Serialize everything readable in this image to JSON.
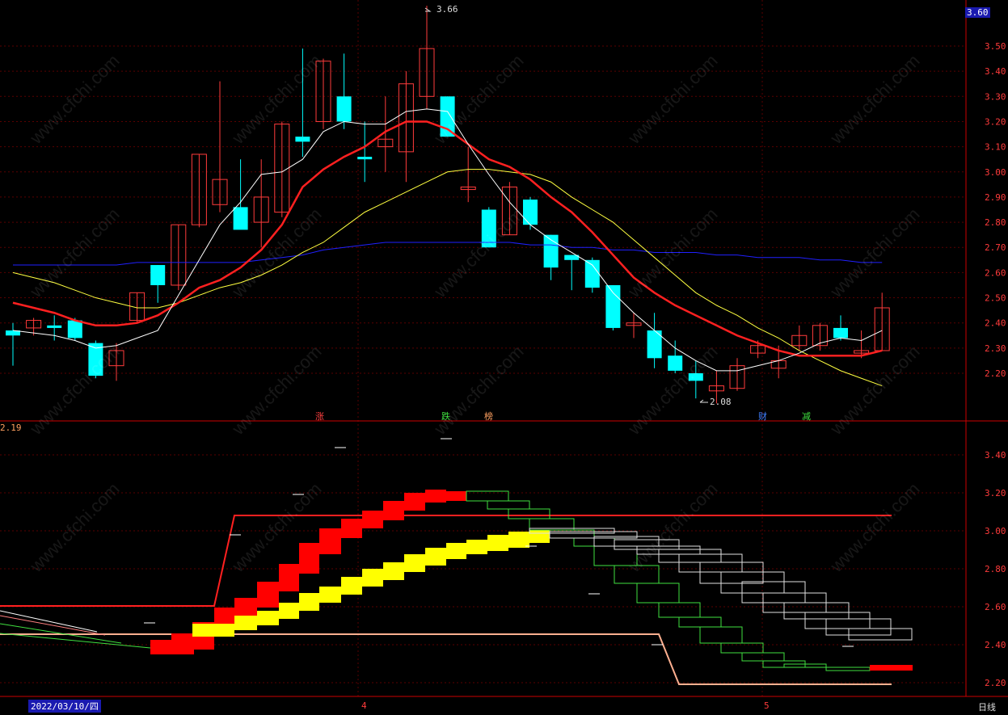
{
  "header": {
    "current_price": "3.60"
  },
  "main_axis_ticks": [
    "3.50",
    "3.40",
    "3.30",
    "3.20",
    "3.10",
    "3.00",
    "2.90",
    "2.80",
    "2.70",
    "2.60",
    "2.50",
    "2.40",
    "2.30",
    "2.20"
  ],
  "lower_axis_ticks": [
    "3.40",
    "3.20",
    "3.00",
    "2.80",
    "2.60",
    "2.40",
    "2.20"
  ],
  "lower_panel": {
    "left_value": "2.19"
  },
  "annotations": {
    "high": "3.66",
    "low": "2.08"
  },
  "markers": [
    {
      "text": "涨",
      "color": "#ff4040"
    },
    {
      "text": "跌",
      "color": "#40e040"
    },
    {
      "text": "榜",
      "color": "#ffa060"
    },
    {
      "text": "财",
      "color": "#4080ff"
    },
    {
      "text": "减",
      "color": "#40e040"
    }
  ],
  "footer": {
    "date": "2022/03/10/四",
    "month_4": "4",
    "month_5": "5",
    "period": "日线"
  },
  "watermark": "www.cfchi.com",
  "colors": {
    "up": "#ff3b3b",
    "down": "#00ffff",
    "ma5": "#ffffff",
    "ma10": "#ff2020",
    "ma20": "#ffff40",
    "ma60": "#2020ff",
    "grid": "#5a0000"
  },
  "chart_data": {
    "type": "candlestick",
    "ylim": [
      2.15,
      3.68
    ],
    "candles": [
      {
        "o": 2.37,
        "h": 2.4,
        "l": 2.23,
        "c": 2.35
      },
      {
        "o": 2.38,
        "h": 2.42,
        "l": 2.35,
        "c": 2.41
      },
      {
        "o": 2.39,
        "h": 2.43,
        "l": 2.33,
        "c": 2.38
      },
      {
        "o": 2.41,
        "h": 2.42,
        "l": 2.33,
        "c": 2.34
      },
      {
        "o": 2.32,
        "h": 2.33,
        "l": 2.18,
        "c": 2.19
      },
      {
        "o": 2.23,
        "h": 2.32,
        "l": 2.17,
        "c": 2.29
      },
      {
        "o": 2.41,
        "h": 2.52,
        "l": 2.4,
        "c": 2.52
      },
      {
        "o": 2.63,
        "h": 2.63,
        "l": 2.48,
        "c": 2.55
      },
      {
        "o": 2.55,
        "h": 2.79,
        "l": 2.53,
        "c": 2.79
      },
      {
        "o": 2.79,
        "h": 3.07,
        "l": 2.78,
        "c": 3.07
      },
      {
        "o": 2.87,
        "h": 3.36,
        "l": 2.84,
        "c": 2.97
      },
      {
        "o": 2.86,
        "h": 3.05,
        "l": 2.78,
        "c": 2.77
      },
      {
        "o": 2.8,
        "h": 3.05,
        "l": 2.7,
        "c": 2.9
      },
      {
        "o": 2.84,
        "h": 3.2,
        "l": 2.82,
        "c": 3.19
      },
      {
        "o": 3.14,
        "h": 3.49,
        "l": 3.06,
        "c": 3.12
      },
      {
        "o": 3.2,
        "h": 3.45,
        "l": 3.17,
        "c": 3.44
      },
      {
        "o": 3.3,
        "h": 3.47,
        "l": 3.17,
        "c": 3.2
      },
      {
        "o": 3.06,
        "h": 3.2,
        "l": 2.96,
        "c": 3.05
      },
      {
        "o": 3.1,
        "h": 3.3,
        "l": 3.0,
        "c": 3.13
      },
      {
        "o": 3.08,
        "h": 3.4,
        "l": 2.96,
        "c": 3.35
      },
      {
        "o": 3.3,
        "h": 3.66,
        "l": 3.25,
        "c": 3.49
      },
      {
        "o": 3.3,
        "h": 3.3,
        "l": 3.14,
        "c": 3.14
      },
      {
        "o": 2.93,
        "h": 3.1,
        "l": 2.88,
        "c": 2.94
      },
      {
        "o": 2.85,
        "h": 2.86,
        "l": 2.7,
        "c": 2.7
      },
      {
        "o": 2.75,
        "h": 2.96,
        "l": 2.75,
        "c": 2.94
      },
      {
        "o": 2.89,
        "h": 2.9,
        "l": 2.77,
        "c": 2.79
      },
      {
        "o": 2.75,
        "h": 2.75,
        "l": 2.57,
        "c": 2.62
      },
      {
        "o": 2.67,
        "h": 2.67,
        "l": 2.53,
        "c": 2.65
      },
      {
        "o": 2.65,
        "h": 2.66,
        "l": 2.52,
        "c": 2.54
      },
      {
        "o": 2.55,
        "h": 2.55,
        "l": 2.37,
        "c": 2.38
      },
      {
        "o": 2.39,
        "h": 2.44,
        "l": 2.34,
        "c": 2.4
      },
      {
        "o": 2.37,
        "h": 2.44,
        "l": 2.22,
        "c": 2.26
      },
      {
        "o": 2.27,
        "h": 2.33,
        "l": 2.2,
        "c": 2.21
      },
      {
        "o": 2.2,
        "h": 2.25,
        "l": 2.1,
        "c": 2.17
      },
      {
        "o": 2.13,
        "h": 2.21,
        "l": 2.08,
        "c": 2.15
      },
      {
        "o": 2.14,
        "h": 2.26,
        "l": 2.13,
        "c": 2.23
      },
      {
        "o": 2.28,
        "h": 2.33,
        "l": 2.26,
        "c": 2.31
      },
      {
        "o": 2.22,
        "h": 2.31,
        "l": 2.18,
        "c": 2.25
      },
      {
        "o": 2.31,
        "h": 2.39,
        "l": 2.29,
        "c": 2.35
      },
      {
        "o": 2.31,
        "h": 2.4,
        "l": 2.29,
        "c": 2.39
      },
      {
        "o": 2.38,
        "h": 2.43,
        "l": 2.33,
        "c": 2.34
      },
      {
        "o": 2.28,
        "h": 2.37,
        "l": 2.26,
        "c": 2.29
      },
      {
        "o": 2.29,
        "h": 2.52,
        "l": 2.29,
        "c": 2.46
      }
    ],
    "ma5": [
      2.37,
      2.36,
      2.35,
      2.33,
      2.3,
      2.31,
      2.34,
      2.37,
      2.51,
      2.65,
      2.79,
      2.88,
      2.99,
      3.0,
      3.05,
      3.16,
      3.2,
      3.19,
      3.19,
      3.24,
      3.25,
      3.24,
      3.11,
      2.99,
      2.88,
      2.79,
      2.73,
      2.68,
      2.63,
      2.52,
      2.44,
      2.37,
      2.3,
      2.25,
      2.21,
      2.21,
      2.23,
      2.25,
      2.28,
      2.32,
      2.34,
      2.33,
      2.37
    ],
    "ma10": [
      2.48,
      2.46,
      2.44,
      2.41,
      2.39,
      2.39,
      2.4,
      2.43,
      2.48,
      2.54,
      2.57,
      2.62,
      2.69,
      2.79,
      2.94,
      3.01,
      3.06,
      3.1,
      3.16,
      3.2,
      3.2,
      3.17,
      3.11,
      3.05,
      3.02,
      2.97,
      2.9,
      2.84,
      2.76,
      2.67,
      2.58,
      2.52,
      2.47,
      2.43,
      2.39,
      2.35,
      2.32,
      2.29,
      2.27,
      2.27,
      2.27,
      2.27,
      2.29
    ],
    "ma20": [
      2.6,
      2.58,
      2.56,
      2.53,
      2.5,
      2.48,
      2.46,
      2.46,
      2.48,
      2.51,
      2.54,
      2.56,
      2.59,
      2.63,
      2.68,
      2.72,
      2.78,
      2.84,
      2.88,
      2.92,
      2.96,
      3.0,
      3.01,
      3.01,
      3.0,
      2.99,
      2.96,
      2.9,
      2.85,
      2.8,
      2.73,
      2.66,
      2.59,
      2.52,
      2.47,
      2.43,
      2.38,
      2.34,
      2.29,
      2.25,
      2.21,
      2.18,
      2.15
    ],
    "ma60": [
      2.63,
      2.63,
      2.63,
      2.63,
      2.63,
      2.63,
      2.64,
      2.64,
      2.64,
      2.64,
      2.64,
      2.64,
      2.65,
      2.66,
      2.67,
      2.69,
      2.7,
      2.71,
      2.72,
      2.72,
      2.72,
      2.72,
      2.72,
      2.72,
      2.72,
      2.71,
      2.71,
      2.7,
      2.7,
      2.69,
      2.69,
      2.68,
      2.68,
      2.68,
      2.67,
      2.67,
      2.66,
      2.66,
      2.66,
      2.65,
      2.65,
      2.64,
      2.64
    ]
  }
}
